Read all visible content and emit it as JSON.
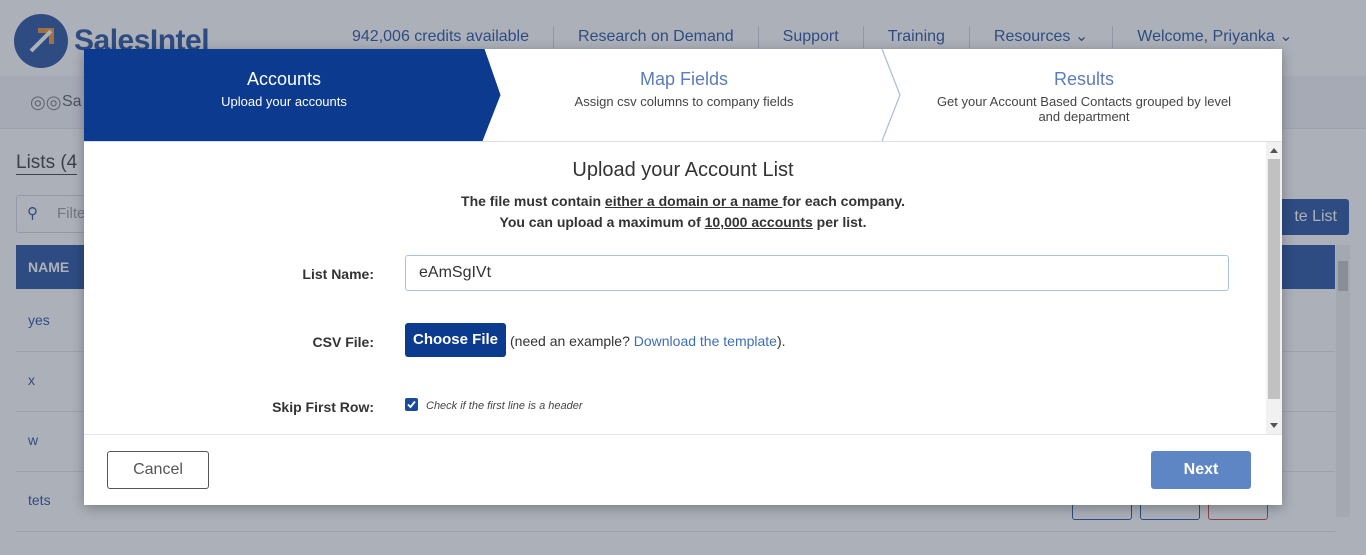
{
  "app": {
    "logo_text": "SalesIntel",
    "nav": [
      "942,006 credits available",
      "Research on Demand",
      "Support",
      "Training",
      "Resources",
      "Welcome, Priyanka"
    ],
    "subbar_label": "Sa",
    "lists_title": "Lists (4",
    "filter_placeholder": "Filte",
    "create_button": "te List",
    "table_header": "NAME",
    "rows": [
      "yes",
      "x",
      "w",
      "tets"
    ]
  },
  "wizard": {
    "steps": [
      {
        "title": "Accounts",
        "subtitle": "Upload your accounts",
        "active": true
      },
      {
        "title": "Map Fields",
        "subtitle": "Assign csv columns to company fields",
        "active": false
      },
      {
        "title": "Results",
        "subtitle": "Get your Account Based Contacts grouped by level and department",
        "active": false
      }
    ]
  },
  "upload": {
    "title": "Upload your Account List",
    "rule1_pre": "The file must contain ",
    "rule1_link": "either a domain or a name ",
    "rule1_post": "for each company.",
    "rule2_pre": "You can upload a maximum of ",
    "rule2_link": "10,000 accounts",
    "rule2_post": " per list.",
    "list_name_label": "List Name:",
    "list_name_value": "eAmSgIVt",
    "csv_label": "CSV File:",
    "choose_file": "Choose File",
    "csv_note_pre": "(need an example? ",
    "csv_note_link": "Download the template",
    "csv_note_post": ").",
    "skip_label": "Skip First Row:",
    "skip_checked": true,
    "skip_note": "Check if the first line is a header"
  },
  "footer": {
    "cancel": "Cancel",
    "next": "Next"
  },
  "colors": {
    "brand": "#1b4a9c",
    "active_step": "#0b3a8e",
    "next_button": "#5f86c4",
    "link": "#3e6fb3"
  }
}
